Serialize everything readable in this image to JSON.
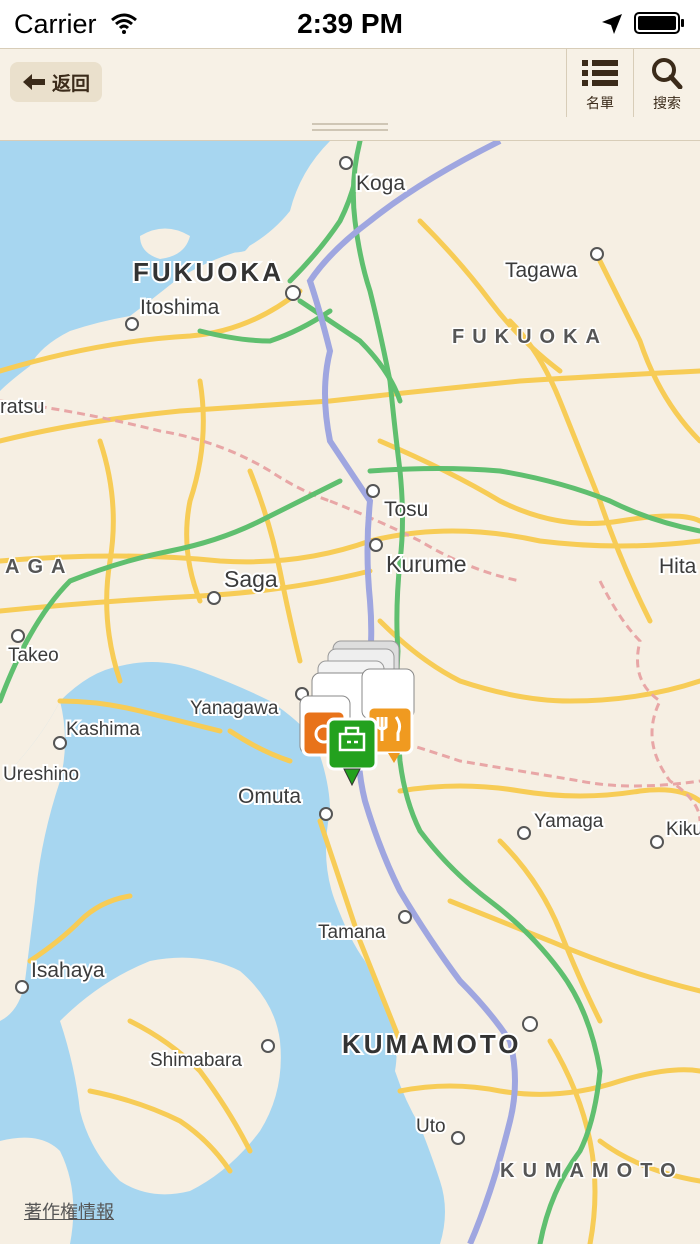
{
  "status_bar": {
    "carrier": "Carrier",
    "time": "2:39 PM"
  },
  "nav": {
    "back_label": "返回",
    "list_label": "名單",
    "search_label": "搜索"
  },
  "map": {
    "cities": {
      "koga": "Koga",
      "fukuoka_city": "FUKUOKA",
      "itoshima": "Itoshima",
      "tagawa": "Tagawa",
      "fukuoka_pref": "FUKUOKA",
      "karatsu": "ratsu",
      "tosu": "Tosu",
      "kurume": "Kurume",
      "saga_pref": "AGA",
      "saga": "Saga",
      "hita": "Hita",
      "takeo": "Takeo",
      "yanagawa": "Yanagawa",
      "kashima": "Kashima",
      "ureshino": "Ureshino",
      "omuta": "Omuta",
      "yamaga": "Yamaga",
      "kiku": "Kiku",
      "tamana": "Tamana",
      "isahaya": "Isahaya",
      "kumamoto_city": "KUMAMOTO",
      "shimabara": "Shimabara",
      "uto": "Uto",
      "kumamoto_pref": "KUMAMOTO"
    },
    "pins": [
      {
        "type": "restaurant",
        "color": "#e8731a",
        "icon": "fork-knife-icon"
      },
      {
        "type": "building",
        "color": "#23a11e",
        "icon": "building-icon"
      },
      {
        "type": "restaurant",
        "color": "#f09a20",
        "icon": "fork-knife-icon"
      }
    ],
    "credit": "著作権情報"
  },
  "colors": {
    "water": "#a7d6f0",
    "land": "#f6efe3",
    "road": "#f7cc56",
    "highway": "#5fbf6f",
    "rail": "#9fa6e0"
  }
}
